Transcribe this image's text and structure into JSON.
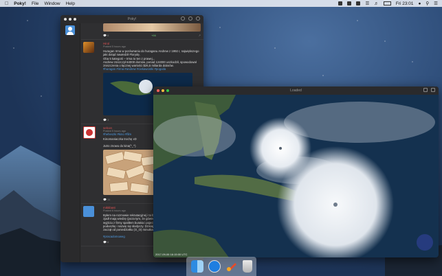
{
  "menubar": {
    "app_name": "Poky!",
    "menus": [
      "File",
      "Window",
      "Help"
    ],
    "clock": "Fri 23:01"
  },
  "poky_window": {
    "title": "Poky!",
    "posts": [
      {
        "name": "",
        "meta": "",
        "text": "",
        "comments": "6",
        "plus": "+66"
      },
      {
        "name": "Hirol",
        "meta": "Posted 5 hours ago",
        "text": "Huragan Irma w porównaniu do huraganu Andrew z 1992 r, największego\njaki dotąd nawiedził Florydę.\nOba 5 kategorii – Irma to ten z prawej...\nAndrew zniszczył 64000 domów, ponad 124000 uszkodził, spowodował\nzniszczenia o łącznej wartości $26,5 miliarda dolarów.",
        "tags": "#huragan #irma #andrew #ciekawostki #pogoda",
        "comments": "3",
        "plus": "+7"
      },
      {
        "name": "selcon",
        "meta": "Posted 5 hours ago",
        "text": "Kinomaniaczka trochę xD",
        "tags": "#heheszki #kino #film",
        "text2": "Jutro znowu do kina(^_^)",
        "comments": "11",
        "plus": "+1"
      },
      {
        "name": "mikkbast",
        "meta": "Posted 6 hours ago",
        "text": "Byłem na rozmowie rekrutacyjnej i to byna\nzjadł mają wiedzę (poza tym, że gówno u\nwyjściu z firmy spaliłem buraka i pojechał\npoduszkę i nazwę się słodyczy. Dzisiaj\nzaczął od poniedziałku (O_O) minutkach",
        "tags": "#pracadomoweg",
        "comments": "6",
        "plus": "+7"
      }
    ]
  },
  "viewer_window": {
    "title": "Loaded",
    "caption": "2017-09-06 16:15:00 UTC"
  },
  "dock": {
    "apps": [
      "Finder",
      "Safari",
      "Poky",
      "Trash"
    ]
  }
}
